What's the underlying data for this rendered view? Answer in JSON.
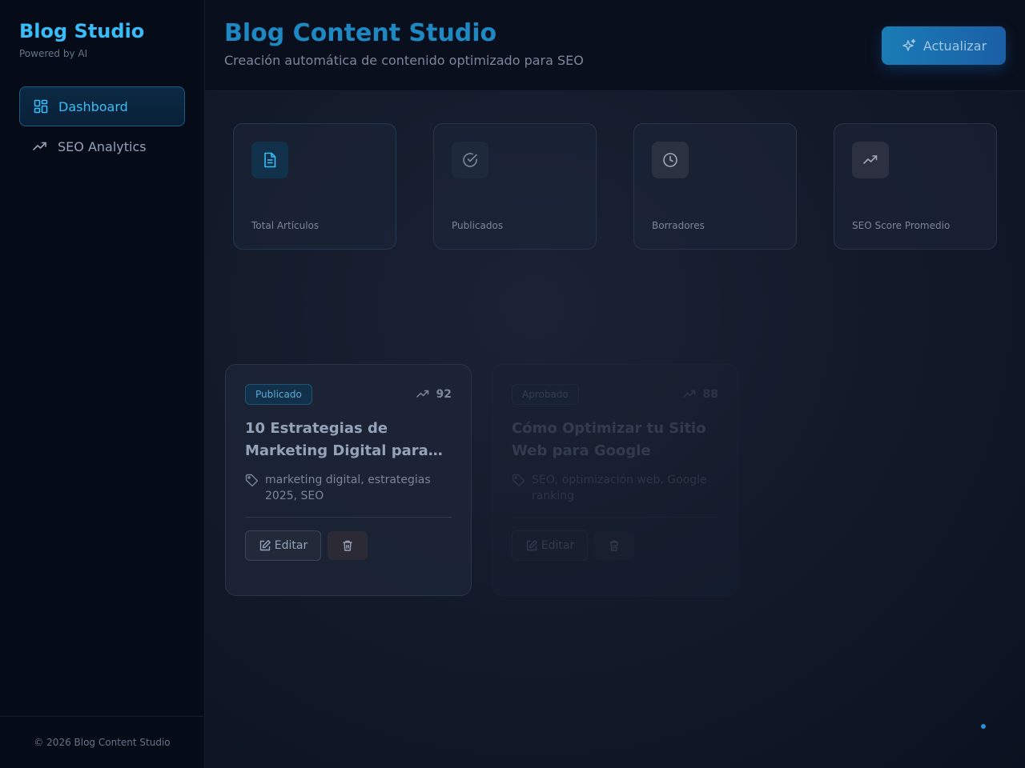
{
  "brand": {
    "title": "Blog Studio",
    "subtitle": "Powered by AI"
  },
  "sidebar": {
    "items": [
      {
        "label": "Dashboard",
        "icon": "dashboard-grid-icon",
        "active": true
      },
      {
        "label": "SEO Analytics",
        "icon": "trending-up-icon",
        "active": false
      }
    ],
    "footer": "© 2026 Blog Content Studio"
  },
  "header": {
    "title": "Blog Content Studio",
    "subtitle": "Creación automática de contenido optimizado para SEO",
    "refresh_label": "Actualizar",
    "refresh_icon": "sparkles-icon"
  },
  "stats": [
    {
      "label": "Total Artículos",
      "icon": "document-icon",
      "color": "#38bdf8"
    },
    {
      "label": "Publicados",
      "icon": "check-circle-icon",
      "color": "#7b8699"
    },
    {
      "label": "Borradores",
      "icon": "clock-icon",
      "color": "#94a3b8"
    },
    {
      "label": "SEO Score Promedio",
      "icon": "trending-up-icon",
      "color": "#94a3b8"
    }
  ],
  "articles": [
    {
      "status": "Publicado",
      "seo_score": "92",
      "title": "10 Estrategias de Marketing Digital para…",
      "tags": "marketing digital, estrategias 2025, SEO",
      "edit_label": "Editar"
    },
    {
      "status": "Aprobado",
      "seo_score": "88",
      "title": "Cómo Optimizar tu Sitio Web para Google",
      "tags": "SEO, optimización web, Google ranking",
      "edit_label": "Editar"
    }
  ],
  "colors": {
    "accent": "#38bdf8",
    "background": "#0b1120",
    "sidebar": "#060b18",
    "button": "#1a7cb5"
  }
}
